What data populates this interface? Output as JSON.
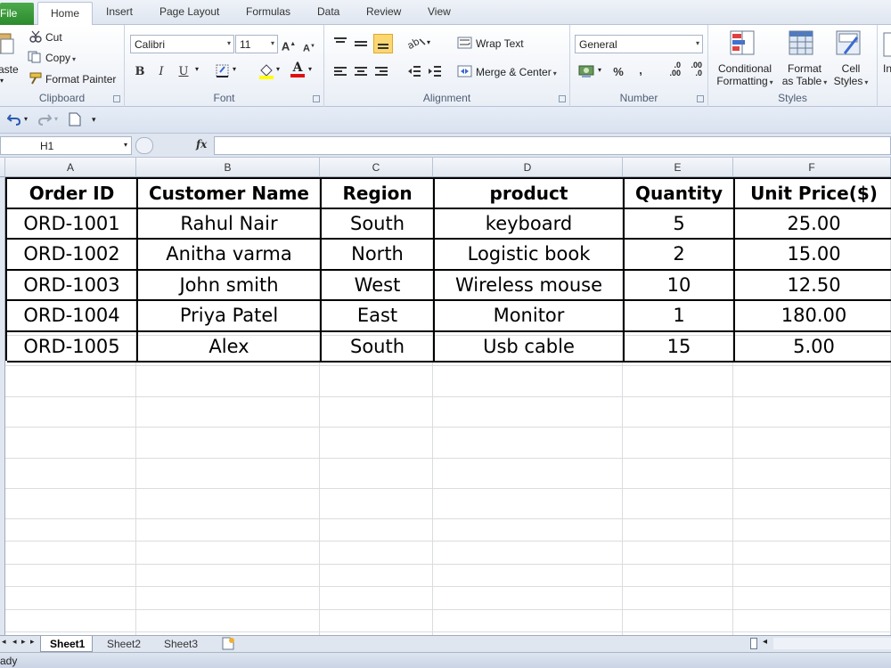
{
  "ribbon_tabs": {
    "file": "File",
    "home": "Home",
    "insert": "Insert",
    "page_layout": "Page Layout",
    "formulas": "Formulas",
    "data": "Data",
    "review": "Review",
    "view": "View"
  },
  "clipboard": {
    "paste": "aste",
    "cut": "Cut",
    "copy": "Copy",
    "format_painter": "Format Painter",
    "label": "Clipboard"
  },
  "font": {
    "family": "Calibri",
    "size": "11",
    "bold": "B",
    "italic": "I",
    "underline": "U",
    "label": "Font",
    "grow": "A",
    "shrink": "A",
    "font_color": "A"
  },
  "alignment": {
    "wrap_text": "Wrap Text",
    "merge_center": "Merge & Center",
    "label": "Alignment"
  },
  "number": {
    "format": "General",
    "percent": "%",
    "comma": ",",
    "inc_decimal": "←.0 .00",
    "dec_decimal": ".00 →.0",
    "label": "Number",
    "inc_decimal_top": ".0",
    "inc_decimal_bottom": ".00",
    "dec_decimal_top": ".00",
    "dec_decimal_bottom": ".0"
  },
  "styles": {
    "conditional_1": "Conditional",
    "conditional_2": "Formatting",
    "format_table_1": "Format",
    "format_table_2": "as Table",
    "cell_styles_1": "Cell",
    "cell_styles_2": "Styles",
    "label": "Styles",
    "insert_cut": "In"
  },
  "formula_bar": {
    "name_box": "H1",
    "fx": "fx",
    "formula": ""
  },
  "columns": [
    "A",
    "B",
    "C",
    "D",
    "E",
    "F"
  ],
  "table": {
    "headers": [
      "Order ID",
      "Customer Name",
      "Region",
      "product",
      "Quantity",
      "Unit Price($)"
    ],
    "rows": [
      [
        "ORD-1001",
        "Rahul Nair",
        "South",
        "keyboard",
        "5",
        "25.00"
      ],
      [
        "ORD-1002",
        "Anitha varma",
        "North",
        "Logistic book",
        "2",
        "15.00"
      ],
      [
        "ORD-1003",
        "John smith",
        "West",
        "Wireless mouse",
        "10",
        "12.50"
      ],
      [
        "ORD-1004",
        "Priya Patel",
        "East",
        "Monitor",
        "1",
        "180.00"
      ],
      [
        "ORD-1005",
        "Alex",
        "South",
        "Usb cable",
        "15",
        "5.00"
      ]
    ]
  },
  "sheets": [
    "Sheet1",
    "Sheet2",
    "Sheet3"
  ],
  "status": {
    "text": "ady"
  },
  "colors": {
    "file_tab": "#2b8a2b",
    "ribbon_bg": "#e9eef6",
    "grid_line": "#dadcdd",
    "table_border": "#000000"
  }
}
